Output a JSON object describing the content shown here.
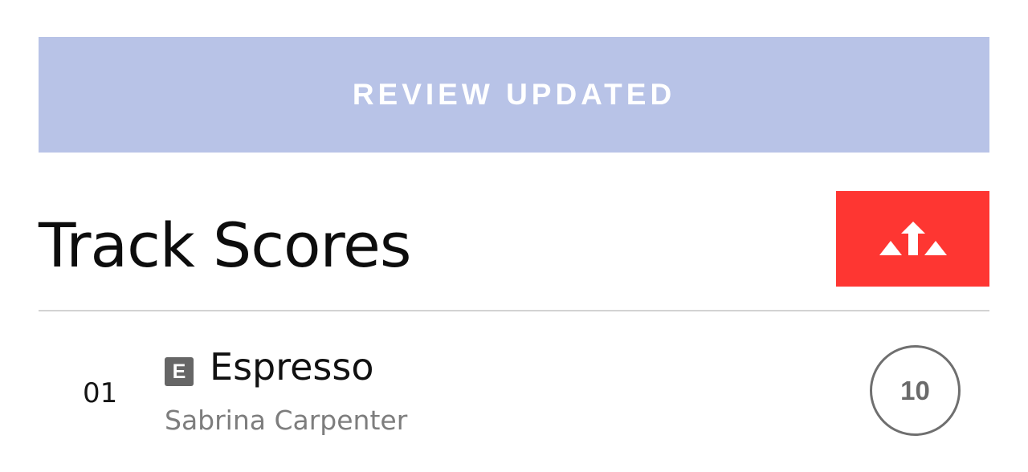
{
  "banner": {
    "label": "Review Updated"
  },
  "section": {
    "title": "Track Scores",
    "share_icon": "share-arrow-icon"
  },
  "tracks": [
    {
      "number": "01",
      "explicit_badge": "E",
      "title": "Espresso",
      "artist": "Sabrina Carpenter",
      "score": "10"
    }
  ],
  "colors": {
    "banner_bg": "#b8c3e7",
    "share_bg": "#fe3632",
    "divider": "#d3d3d3",
    "badge_bg": "#666666",
    "score_ring": "#6f6f6f",
    "artist_text": "#7d7d7d"
  }
}
